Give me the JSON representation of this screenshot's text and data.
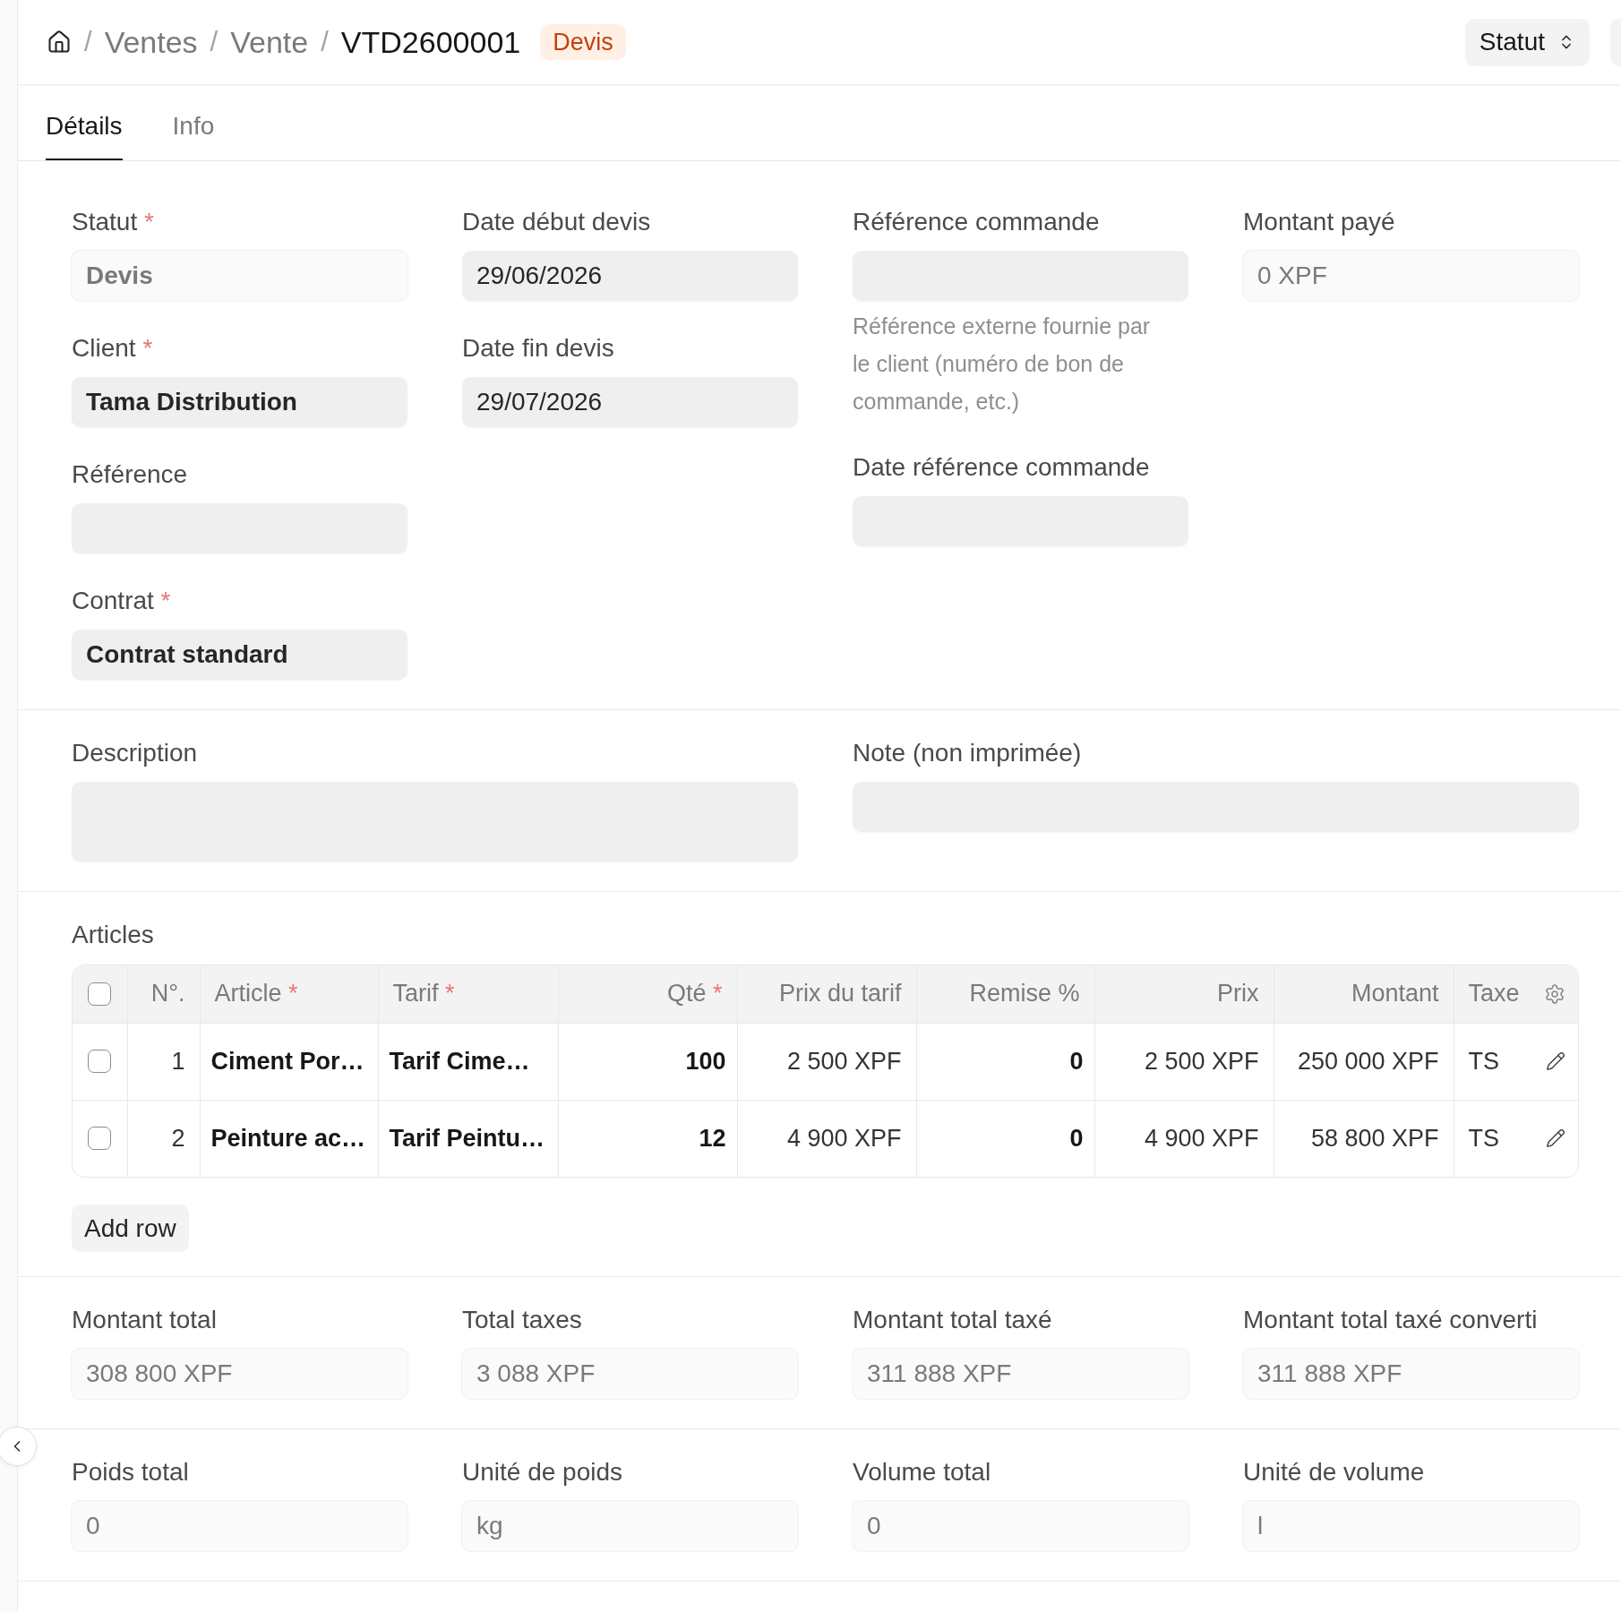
{
  "breadcrumb": {
    "items": [
      {
        "label": "Ventes",
        "separator": "/",
        "current": false
      },
      {
        "label": "Vente",
        "separator": "/",
        "current": false
      },
      {
        "label": "VTD2600001",
        "separator": "/",
        "current": true
      }
    ],
    "badge": "Devis"
  },
  "header_actions": [
    {
      "kind": "select",
      "label": "Statut"
    },
    {
      "kind": "button"
    }
  ],
  "tabs": [
    {
      "label": "Détails",
      "selected": true
    },
    {
      "label": "Info",
      "selected": false
    }
  ],
  "sections": [
    {
      "kind": "fields",
      "columns": [
        {
          "fields": [
            {
              "label": "Statut",
              "required_mark": "*",
              "kind": "link",
              "value": "Devis",
              "disabled": true
            },
            {
              "label": "Client",
              "required_mark": "*",
              "kind": "link",
              "value": "Tama Distribution",
              "disabled": false
            },
            {
              "label": "Référence",
              "kind": "data",
              "disabled": false
            },
            {
              "label": "Contrat",
              "required_mark": "*",
              "kind": "link",
              "value": "Contrat standard",
              "disabled": false
            }
          ]
        },
        {
          "fields": [
            {
              "label": "Date début devis",
              "kind": "date",
              "value": "29/06/2026",
              "disabled": false
            },
            {
              "label": "Date fin devis",
              "kind": "date",
              "value": "29/07/2026",
              "disabled": false
            }
          ]
        },
        {
          "fields": [
            {
              "label": "Référence commande",
              "kind": "data",
              "disabled": false,
              "description": "Référence externe fournie par le client (numéro de bon de commande, etc.)"
            },
            {
              "label": "Date référence commande",
              "kind": "date",
              "disabled": false
            }
          ]
        },
        {
          "fields": [
            {
              "label": "Montant payé",
              "kind": "currency",
              "value": "0 XPF",
              "disabled": true
            }
          ]
        }
      ]
    },
    {
      "kind": "fields",
      "columns": [
        {
          "fields": [
            {
              "label": "Description",
              "kind": "text",
              "disabled": false
            }
          ]
        },
        {
          "fields": [
            {
              "label": "Note (non imprimée)",
              "kind": "small_text",
              "disabled": false
            }
          ]
        }
      ]
    },
    {
      "kind": "table",
      "label": "Articles",
      "header_checked": false,
      "columns": [
        {
          "label": "N°.",
          "kind": "index"
        },
        {
          "label": "Article",
          "required_mark": "*",
          "kind": "link"
        },
        {
          "label": "Tarif",
          "required_mark": "*",
          "kind": "link"
        },
        {
          "label": "Qté",
          "required_mark": "*",
          "kind": "float"
        },
        {
          "label": "Prix du tarif",
          "kind": "currency"
        },
        {
          "label": "Remise %",
          "kind": "float"
        },
        {
          "label": "Prix",
          "kind": "currency"
        },
        {
          "label": "Montant",
          "kind": "currency"
        },
        {
          "label": "Taxe",
          "kind": "data"
        }
      ],
      "rows": [
        {
          "checked": false,
          "cells": [
            "1",
            "Ciment Por…",
            "Tarif Cime…",
            "100",
            "2 500 XPF",
            "0",
            "2 500 XPF",
            "250 000 XPF",
            "TS"
          ]
        },
        {
          "checked": false,
          "cells": [
            "2",
            "Peinture ac…",
            "Tarif Peintu…",
            "12",
            "4 900 XPF",
            "0",
            "4 900 XPF",
            "58 800 XPF",
            "TS"
          ]
        }
      ],
      "add_button": "Add row"
    },
    {
      "kind": "fields",
      "columns": [
        {
          "fields": [
            {
              "label": "Montant total",
              "kind": "currency",
              "value": "308 800 XPF",
              "disabled": true
            }
          ]
        },
        {
          "fields": [
            {
              "label": "Total taxes",
              "kind": "currency",
              "value": "3 088 XPF",
              "disabled": true
            }
          ]
        },
        {
          "fields": [
            {
              "label": "Montant total taxé",
              "kind": "currency",
              "value": "311 888 XPF",
              "disabled": true
            }
          ]
        },
        {
          "fields": [
            {
              "label": "Montant total taxé converti",
              "kind": "currency",
              "value": "311 888 XPF",
              "disabled": true
            }
          ]
        }
      ]
    },
    {
      "kind": "fields",
      "columns": [
        {
          "fields": [
            {
              "label": "Poids total",
              "kind": "float",
              "value": "0",
              "disabled": true
            }
          ]
        },
        {
          "fields": [
            {
              "label": "Unité de poids",
              "kind": "data",
              "value": "kg",
              "disabled": true
            }
          ]
        },
        {
          "fields": [
            {
              "label": "Volume total",
              "kind": "float",
              "value": "0",
              "disabled": true
            }
          ]
        },
        {
          "fields": [
            {
              "label": "Unité de volume",
              "kind": "data",
              "value": "l",
              "disabled": true
            }
          ]
        }
      ]
    }
  ]
}
